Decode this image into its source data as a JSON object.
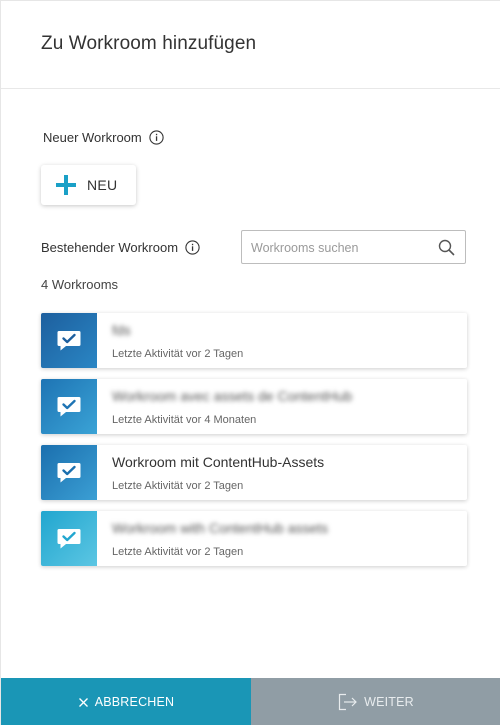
{
  "dialog": {
    "title": "Zu Workroom hinzufügen"
  },
  "new_section": {
    "label": "Neuer Workroom",
    "info_icon": "info-icon",
    "new_button_label": "NEU",
    "new_button_icon": "plus-icon"
  },
  "existing_section": {
    "label": "Bestehender Workroom",
    "info_icon": "info-icon",
    "search_placeholder": "Workrooms suchen",
    "search_value": "",
    "search_icon": "search-icon",
    "count_text": "4 Workrooms"
  },
  "workrooms": [
    {
      "name": "fds",
      "activity": "Letzte Aktivität vor 2 Tagen",
      "blurred": true,
      "color_from": "#1d5f9e",
      "color_to": "#2a86c4"
    },
    {
      "name": "Workroom avec assets de ContentHub",
      "activity": "Letzte Aktivität vor 4 Monaten",
      "blurred": true,
      "color_from": "#1e74b4",
      "color_to": "#3aa3d6"
    },
    {
      "name": "Workroom mit ContentHub-Assets",
      "activity": "Letzte Aktivität vor 2 Tagen",
      "blurred": false,
      "color_from": "#1b6fae",
      "color_to": "#3b9fd4"
    },
    {
      "name": "Workroom with ContentHub assets",
      "activity": "Letzte Aktivität vor 2 Tagen",
      "blurred": true,
      "color_from": "#21a6cf",
      "color_to": "#5cc6e3"
    }
  ],
  "footer": {
    "cancel_label": "ABBRECHEN",
    "cancel_icon": "close-icon",
    "next_label": "WEITER",
    "next_icon": "exit-arrow-icon"
  },
  "colors": {
    "accent": "#1a96b6",
    "disabled": "#909da5"
  }
}
